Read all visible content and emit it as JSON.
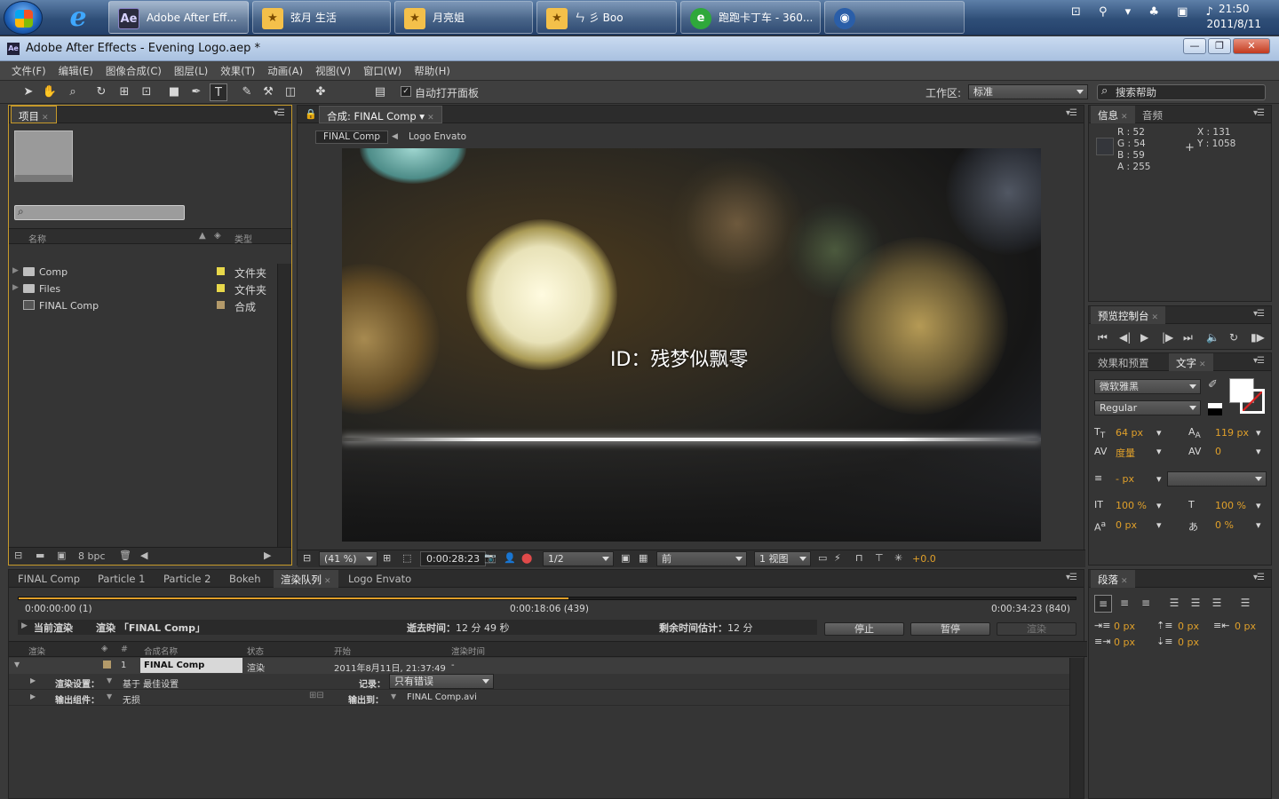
{
  "taskbar": {
    "tasks": [
      {
        "label": "Adobe After Eff...",
        "icon": "ae-icon"
      },
      {
        "label": "弦月 生活",
        "icon": "qq-space-icon"
      },
      {
        "label": "月亮姐",
        "icon": "qq-space-icon"
      },
      {
        "label": "ㄣ 彡 Boo",
        "icon": "qq-space-icon"
      },
      {
        "label": "跑跑卡丁车 - 360...",
        "icon": "360-browser-icon"
      }
    ],
    "clock_time": "21:50",
    "clock_date": "2011/8/11"
  },
  "window": {
    "title": "Adobe After Effects - Evening Logo.aep *"
  },
  "menu": [
    "文件(F)",
    "编辑(E)",
    "图像合成(C)",
    "图层(L)",
    "效果(T)",
    "动画(A)",
    "视图(V)",
    "窗口(W)",
    "帮助(H)"
  ],
  "toolbar": {
    "auto_open_label": "自动打开面板",
    "workspace_label": "工作区:",
    "workspace_value": "标准",
    "search_help": "搜索帮助"
  },
  "project": {
    "tab": "项目",
    "col_name": "名称",
    "col_type": "类型",
    "items": [
      {
        "name": "Comp",
        "type": "文件夹",
        "kind": "folder",
        "color": "#e8d84a"
      },
      {
        "name": "Files",
        "type": "文件夹",
        "kind": "folder",
        "color": "#e8d84a"
      },
      {
        "name": "FINAL Comp",
        "type": "合成",
        "kind": "comp",
        "color": "#b39a6a"
      }
    ],
    "bpc": "8 bpc"
  },
  "comp": {
    "tab": "合成: FINAL Comp",
    "breadcrumb_active": "FINAL Comp",
    "breadcrumb_next": "Logo Envato",
    "viewer_text": "ID：残梦似飘零",
    "zoom": "(41 %)",
    "timecode": "0:00:28:23",
    "resolution": "1/2",
    "view": "前",
    "views": "1 视图",
    "exposure": "+0.0"
  },
  "info": {
    "tab": "信息",
    "tab2": "音频",
    "r": "R : 52",
    "g": "G : 54",
    "b": "B : 59",
    "a": "A : 255",
    "x": "X : 131",
    "y": "Y : 1058"
  },
  "preview": {
    "tab": "预览控制台"
  },
  "character": {
    "tab_effects": "效果和预置",
    "tab_text": "文字",
    "font": "微软雅黑",
    "style": "Regular",
    "size": "64",
    "leading": "119",
    "kerning": "度量",
    "tracking": "0",
    "stroke": "-",
    "vscale": "100",
    "hscale": "100",
    "baseline": "0",
    "tsume": "0",
    "unit_px": "px",
    "unit_pct": "%"
  },
  "paragraph": {
    "tab": "段落",
    "v1": "0",
    "v2": "0",
    "v3": "0",
    "v4": "0",
    "v5": "0"
  },
  "bottom_tabs": [
    "FINAL Comp",
    "Particle 1",
    "Particle 2",
    "Bokeh",
    "渲染队列",
    "Logo Envato"
  ],
  "render": {
    "progress": 0.52,
    "start_time": "0:00:00:00 (1)",
    "mid_time": "0:00:18:06 (439)",
    "end_time": "0:00:34:23 (840)",
    "current_label": "当前渲染",
    "rendering": "渲染 「FINAL Comp」",
    "elapsed_label": "逝去时间：",
    "elapsed": "12 分 49 秒",
    "remaining_label": "剩余时间估计：",
    "remaining": "12 分",
    "stop": "停止",
    "pause": "暂停",
    "render_btn": "渲染",
    "cols": [
      "渲染",
      "#",
      "合成名称",
      "状态",
      "开始",
      "渲染时间"
    ],
    "row": {
      "num": "1",
      "name": "FINAL Comp",
      "status": "渲染",
      "start": "2011年8月11日, 21:37:49",
      "time": "-"
    },
    "settings_label": "渲染设置：",
    "settings_value": "基于 最佳设置",
    "log_label": "记录：",
    "log_value": "只有错误",
    "output_label": "输出组件：",
    "output_value": "无损",
    "output_to_label": "输出到：",
    "output_to_value": "FINAL Comp.avi"
  }
}
